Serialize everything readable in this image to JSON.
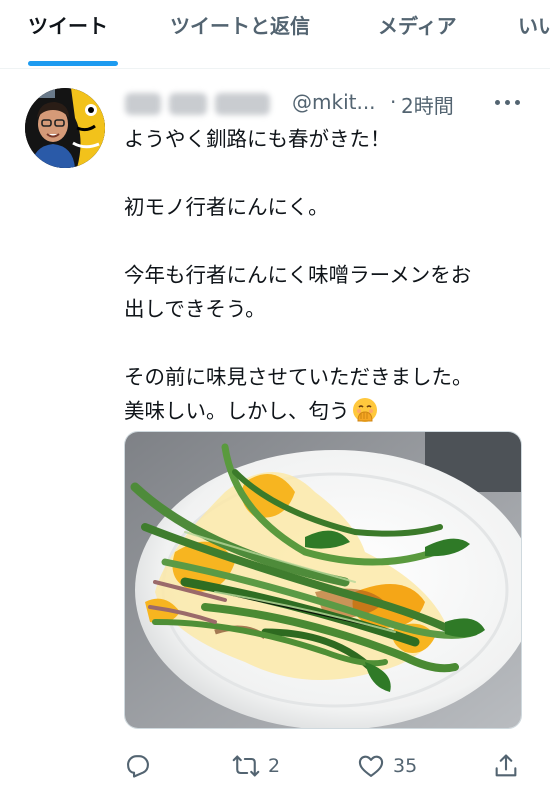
{
  "tabs": [
    {
      "label": "ツイート",
      "active": true
    },
    {
      "label": "ツイートと返信",
      "active": false
    },
    {
      "label": "メディア",
      "active": false
    },
    {
      "label": "いい",
      "active": false
    }
  ],
  "tweet": {
    "handle": "@mkit...",
    "separator": "·",
    "time": "2時間",
    "text_lines": [
      "ようやく釧路にも春がきた！",
      "",
      "初モノ行者にんにく。",
      "",
      "今年も行者にんにく味噌ラーメンをお",
      "出しできそう。",
      "",
      "その前に味見させていただきました。",
      "美味しい。しかし、匂う"
    ],
    "emoji": "face-with-hand-over-mouth-emoji"
  },
  "actions": {
    "reply_icon": "reply-icon",
    "retweet_icon": "retweet-icon",
    "retweet_count": "2",
    "like_icon": "heart-icon",
    "like_count": "35",
    "share_icon": "share-icon"
  },
  "colors": {
    "accent": "#1d9bf0",
    "text_primary": "#0f1419",
    "text_secondary": "#536471",
    "divider": "#eff3f4"
  }
}
